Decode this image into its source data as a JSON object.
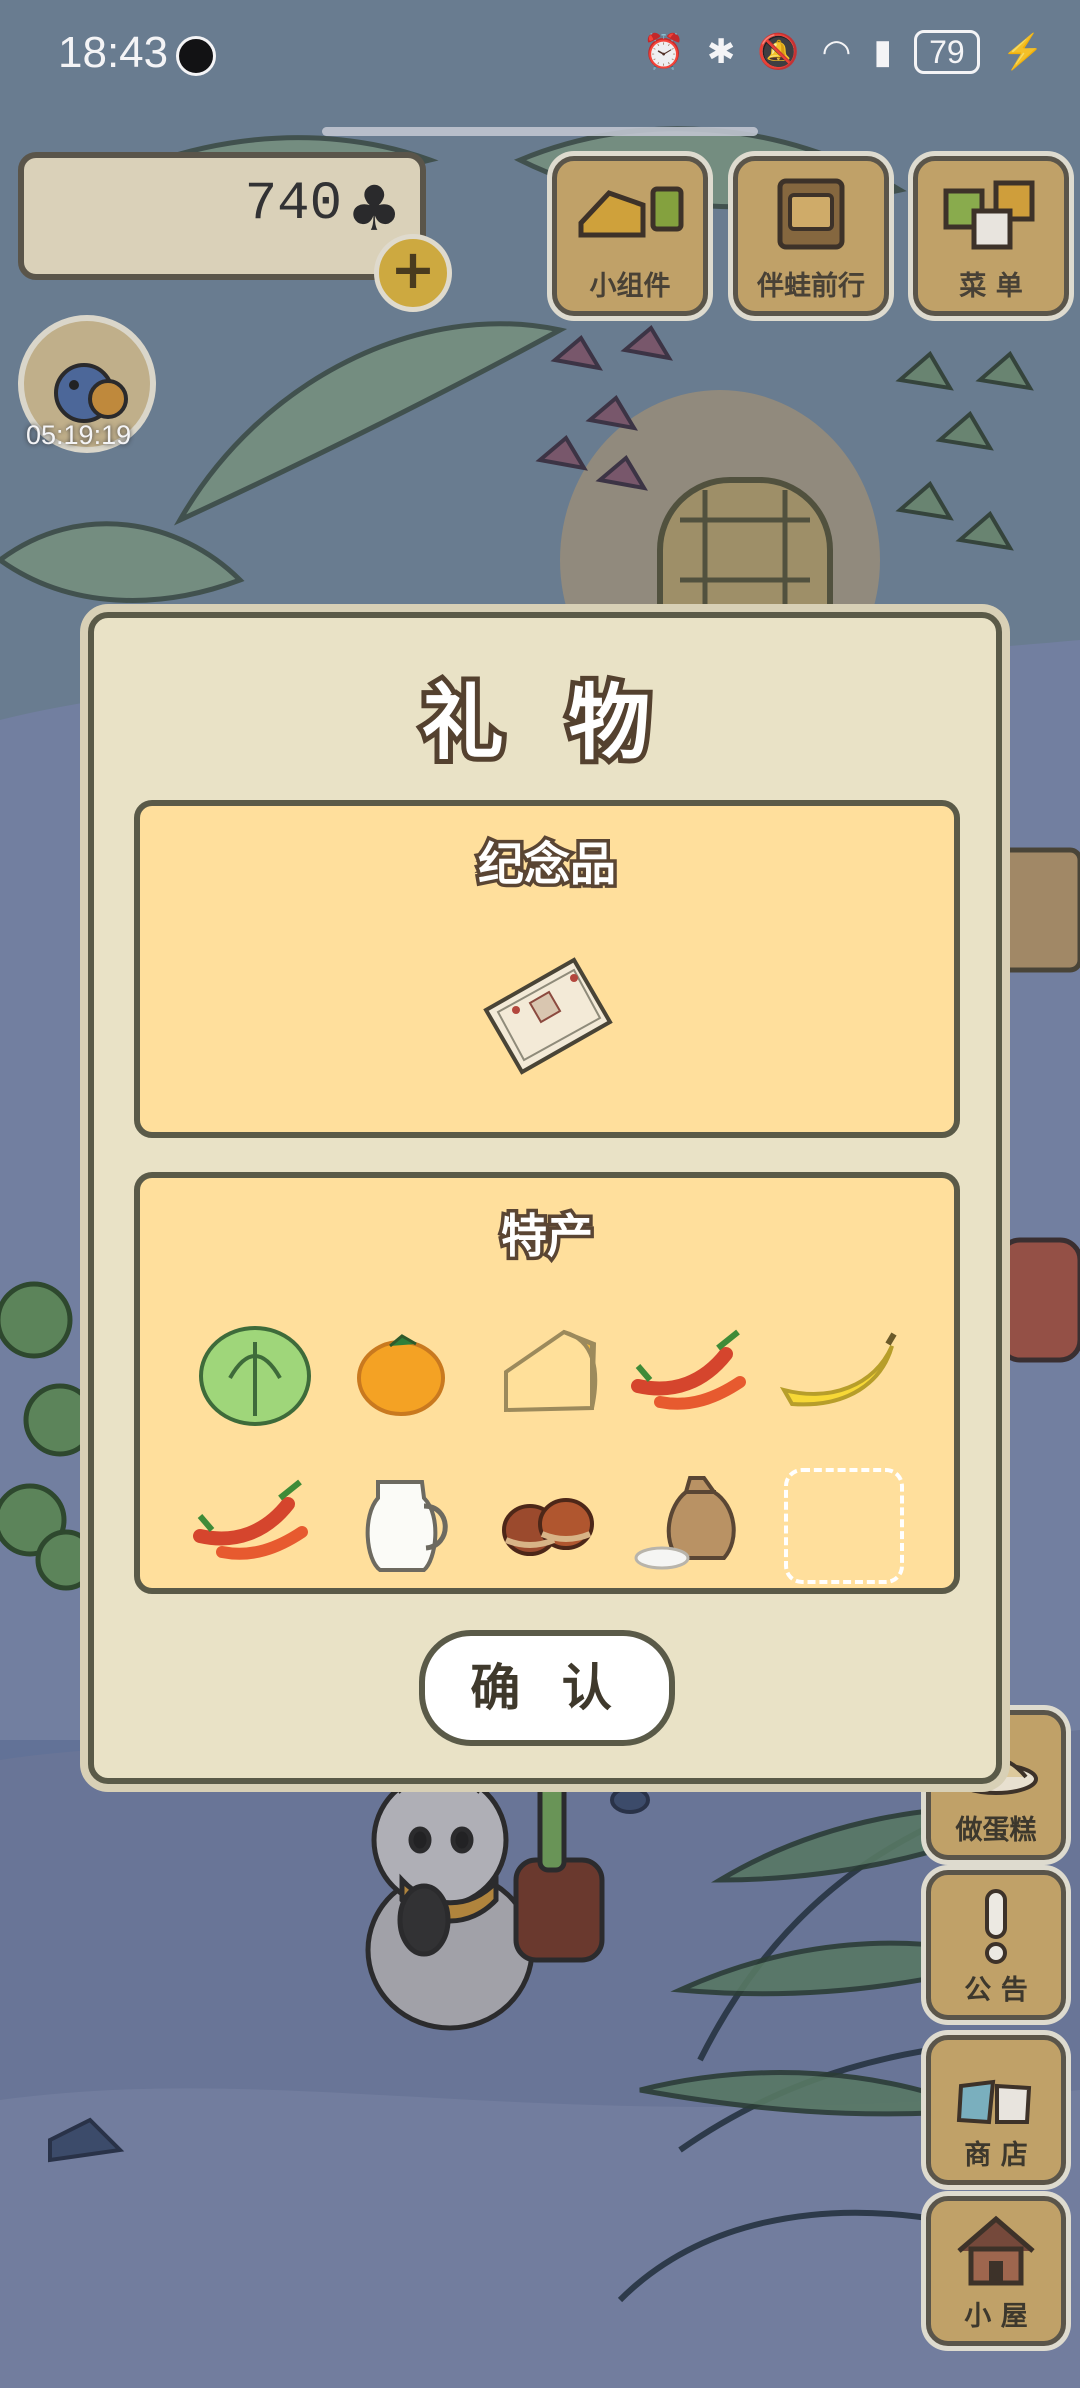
{
  "status_bar": {
    "time": "18:43",
    "battery": "79"
  },
  "hud": {
    "clover_count": "740",
    "timer": "05:19:19",
    "buttons": [
      {
        "label": "小组件",
        "icon": "widget-icon"
      },
      {
        "label": "伴蛙前行",
        "icon": "journey-book-icon"
      },
      {
        "label": "菜 单",
        "icon": "menu-cards-icon"
      }
    ],
    "side_buttons": [
      {
        "label": "做蛋糕",
        "icon": "cake-icon"
      },
      {
        "label": "公 告",
        "icon": "exclamation-icon"
      },
      {
        "label": "商 店",
        "icon": "shop-bags-icon"
      },
      {
        "label": "小 屋",
        "icon": "house-icon"
      }
    ]
  },
  "dialog": {
    "title": "礼 物",
    "souvenir_title": "纪念品",
    "souvenir_item": "booklet-icon",
    "specialty_title": "特产",
    "specialty_items": [
      "cabbage-icon",
      "orange-icon",
      "cheese-icon",
      "chili-peppers-icon",
      "banana-icon",
      "chili-peppers-icon",
      "milk-jug-icon",
      "chestnuts-icon",
      "rice-sack-icon",
      "empty-slot"
    ],
    "confirm_label": "确 认"
  },
  "colors": {
    "panel": "#ffdf9c",
    "dialog": "#e9e2c6",
    "wood": "#c9a86a",
    "outline": "#5a5a48"
  }
}
